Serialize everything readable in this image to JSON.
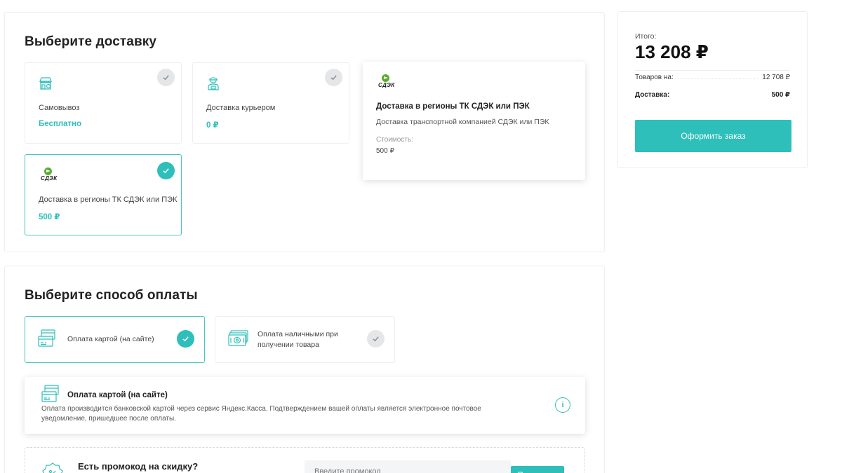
{
  "delivery": {
    "title": "Выберите доставку",
    "options": [
      {
        "label": "Самовывоз",
        "price": "Бесплатно",
        "selected": false
      },
      {
        "label": "Доставка курьером",
        "price": "0 ₽",
        "selected": false
      },
      {
        "label": "Доставка в регионы ТК СДЭК или ПЭК",
        "price": "500 ₽",
        "selected": true,
        "logo": "СДЭК"
      }
    ],
    "detail": {
      "logo": "СДЭК",
      "title": "Доставка в регионы ТК СДЭК или ПЭК",
      "description": "Доставка транспортной компанией СДЭК или ПЭК",
      "cost_label": "Стоимость:",
      "cost_value": "500 ₽"
    }
  },
  "payment": {
    "title": "Выберите способ оплаты",
    "options": [
      {
        "label": "Оплата картой (на сайте)",
        "selected": true
      },
      {
        "label": "Оплата наличными при получении товара",
        "selected": false
      }
    ],
    "detail": {
      "title": "Оплата картой (на сайте)",
      "description": "Оплата производится банковской картой через сервис Яндекс.Касса. Подтверждением вашей оплаты является электронное почтовое уведомление, пришедшее после оплаты.",
      "info_icon": "i"
    }
  },
  "promo": {
    "title": "Есть промокод на скидку?",
    "placeholder": "Введите промокод",
    "button": "Применить"
  },
  "summary": {
    "total_label": "Итого:",
    "total_value": "13 208 ₽",
    "goods_label": "Товаров на:",
    "goods_value": "12 708 ₽",
    "delivery_label": "Доставка:",
    "delivery_value": "500 ₽",
    "order_button": "Оформить заказ"
  },
  "colors": {
    "accent": "#2ebfba",
    "border": "#eceef0",
    "check_off": "#e4e6e8"
  },
  "icons": [
    "store-pickup-icon",
    "courier-icon",
    "cdek-logo",
    "check-icon",
    "credit-card-icon",
    "cash-icon",
    "info-icon",
    "discount-badge-icon"
  ]
}
